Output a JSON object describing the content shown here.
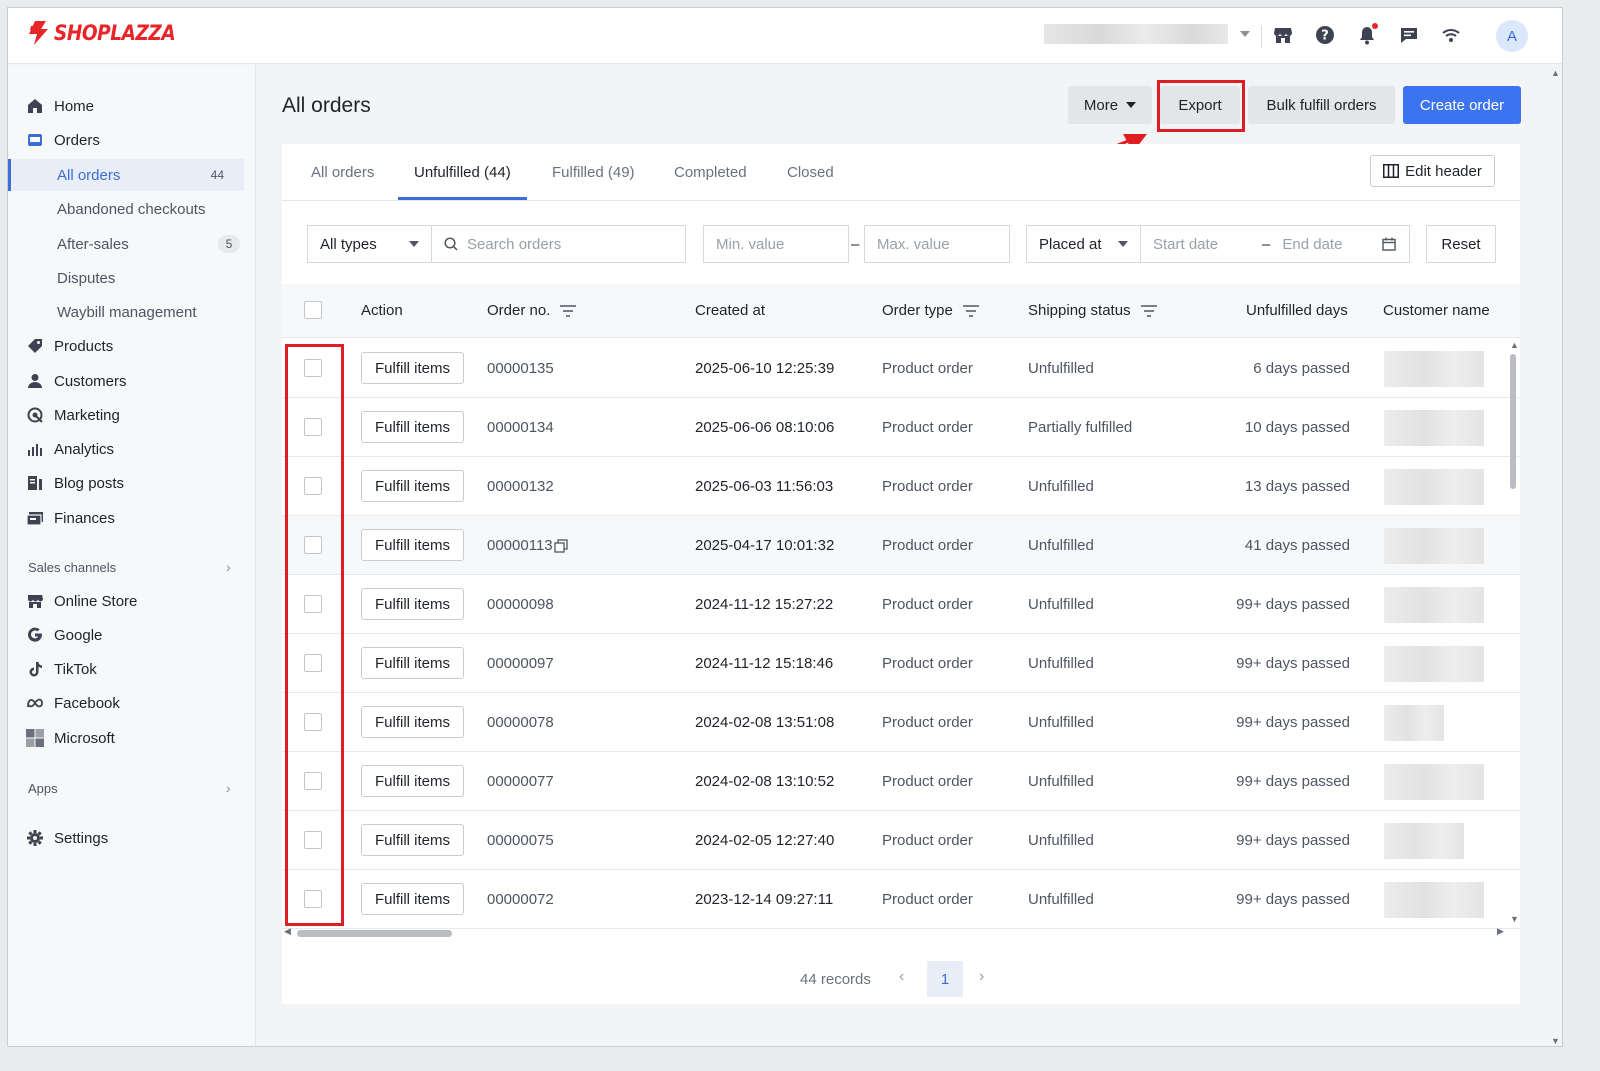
{
  "brand": {
    "name": "SHOPLAZZA",
    "color": "#e8262a"
  },
  "topbar": {
    "icons": [
      "store-icon",
      "help-icon",
      "bell-icon",
      "chat-icon",
      "wifi-icon"
    ],
    "avatar_initial": "A"
  },
  "sidebar": {
    "main": [
      {
        "label": "Home",
        "icon": "home-icon"
      },
      {
        "label": "Orders",
        "icon": "orders-icon"
      }
    ],
    "orders_sub": [
      {
        "label": "All orders",
        "badge": "44",
        "active": true
      },
      {
        "label": "Abandoned checkouts",
        "badge": ""
      },
      {
        "label": "After-sales",
        "badge": "5"
      },
      {
        "label": "Disputes",
        "badge": ""
      },
      {
        "label": "Waybill management",
        "badge": ""
      }
    ],
    "more": [
      {
        "label": "Products",
        "icon": "tag-icon"
      },
      {
        "label": "Customers",
        "icon": "person-icon"
      },
      {
        "label": "Marketing",
        "icon": "marketing-icon"
      },
      {
        "label": "Analytics",
        "icon": "analytics-icon"
      },
      {
        "label": "Blog posts",
        "icon": "blog-icon"
      },
      {
        "label": "Finances",
        "icon": "finances-icon"
      }
    ],
    "sales_channels_label": "Sales channels",
    "channels": [
      {
        "label": "Online Store",
        "icon": "store-icon"
      },
      {
        "label": "Google",
        "icon": "google-icon"
      },
      {
        "label": "TikTok",
        "icon": "tiktok-icon"
      },
      {
        "label": "Facebook",
        "icon": "meta-icon"
      },
      {
        "label": "Microsoft",
        "icon": "microsoft-icon"
      }
    ],
    "apps_label": "Apps",
    "settings_label": "Settings"
  },
  "page": {
    "title": "All orders",
    "buttons": {
      "more": "More",
      "export": "Export",
      "bulk": "Bulk fulfill orders",
      "create": "Create order"
    }
  },
  "tabs": [
    {
      "label": "All orders",
      "active": false
    },
    {
      "label": "Unfulfilled  (44)",
      "active": true
    },
    {
      "label": "Fulfilled  (49)",
      "active": false
    },
    {
      "label": "Completed",
      "active": false
    },
    {
      "label": "Closed",
      "active": false
    }
  ],
  "edit_header": "Edit header",
  "filters": {
    "type": "All types",
    "search_placeholder": "Search orders",
    "min_placeholder": "Min. value",
    "max_placeholder": "Max. value",
    "date_field": "Placed at",
    "start_placeholder": "Start date",
    "end_placeholder": "End date",
    "reset": "Reset"
  },
  "table": {
    "headers": {
      "action": "Action",
      "order_no": "Order no.",
      "created": "Created at",
      "type": "Order type",
      "shipping": "Shipping status",
      "days": "Unfulfilled days",
      "customer": "Customer name"
    },
    "action_label": "Fulfill items",
    "rows": [
      {
        "order": "00000135",
        "created": "2025-06-10 12:25:39",
        "type": "Product order",
        "shipping": "Unfulfilled",
        "days": "6 days passed"
      },
      {
        "order": "00000134",
        "created": "2025-06-06 08:10:06",
        "type": "Product order",
        "shipping": "Partially fulfilled",
        "days": "10 days passed"
      },
      {
        "order": "00000132",
        "created": "2025-06-03 11:56:03",
        "type": "Product order",
        "shipping": "Unfulfilled",
        "days": "13 days passed"
      },
      {
        "order": "00000113",
        "created": "2025-04-17 10:01:32",
        "type": "Product order",
        "shipping": "Unfulfilled",
        "days": "41 days passed"
      },
      {
        "order": "00000098",
        "created": "2024-11-12 15:27:22",
        "type": "Product order",
        "shipping": "Unfulfilled",
        "days": "99+ days passed"
      },
      {
        "order": "00000097",
        "created": "2024-11-12 15:18:46",
        "type": "Product order",
        "shipping": "Unfulfilled",
        "days": "99+ days passed"
      },
      {
        "order": "00000078",
        "created": "2024-02-08 13:51:08",
        "type": "Product order",
        "shipping": "Unfulfilled",
        "days": "99+ days passed"
      },
      {
        "order": "00000077",
        "created": "2024-02-08 13:10:52",
        "type": "Product order",
        "shipping": "Unfulfilled",
        "days": "99+ days passed"
      },
      {
        "order": "00000075",
        "created": "2024-02-05 12:27:40",
        "type": "Product order",
        "shipping": "Unfulfilled",
        "days": "99+ days passed"
      },
      {
        "order": "00000072",
        "created": "2023-12-14 09:27:11",
        "type": "Product order",
        "shipping": "Unfulfilled",
        "days": "99+ days passed"
      }
    ]
  },
  "pagination": {
    "records": "44 records",
    "current_page": "1"
  },
  "colors": {
    "primary": "#3b74ee",
    "highlight": "#e01d24"
  }
}
